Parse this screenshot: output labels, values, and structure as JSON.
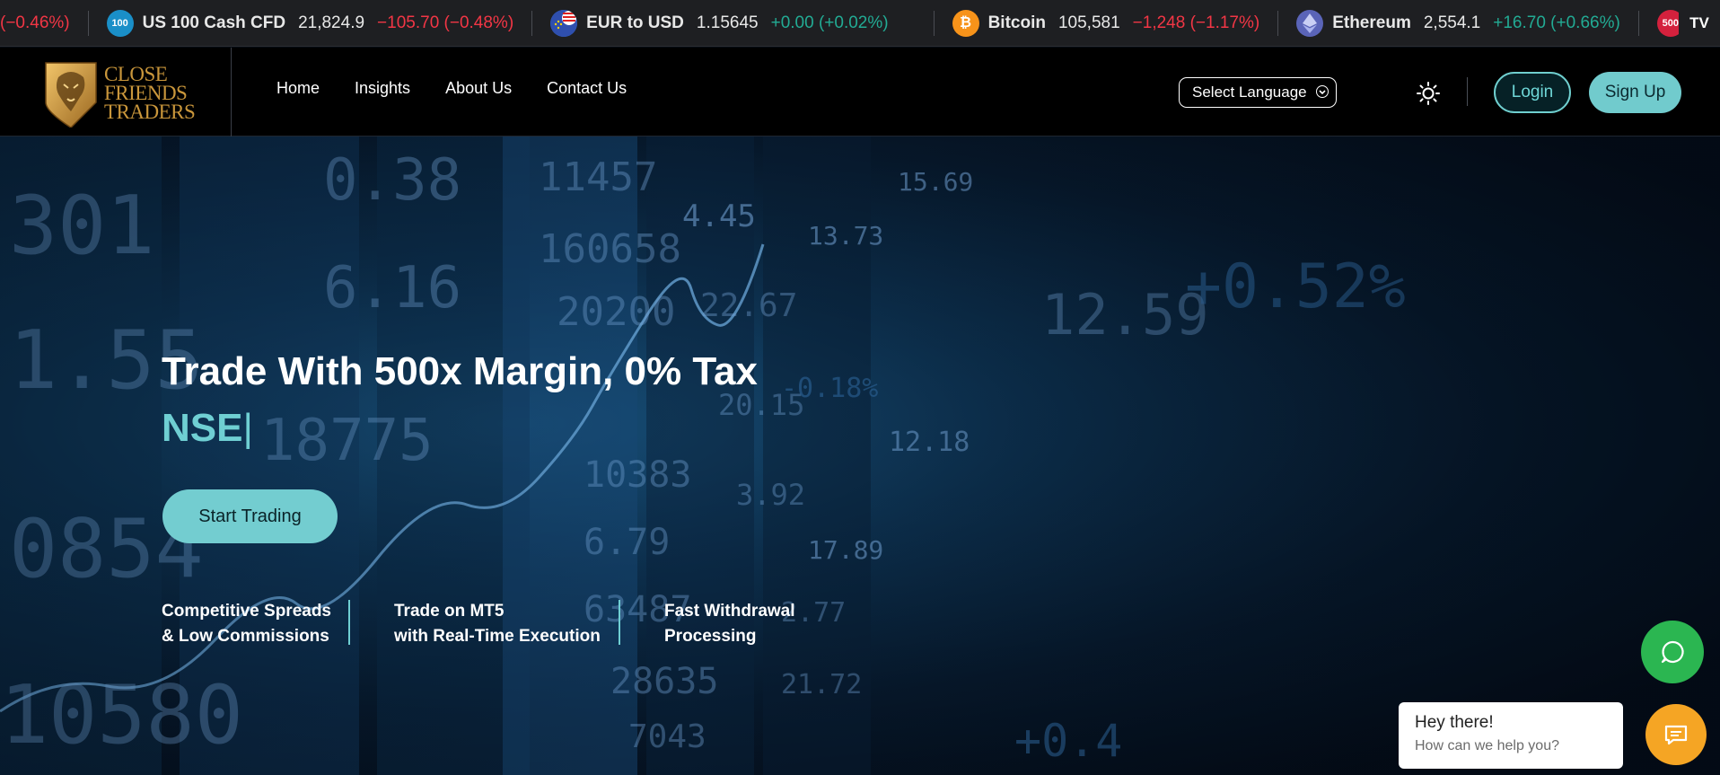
{
  "ticker": [
    {
      "name": "",
      "price": "",
      "change": "(−0.46%)",
      "direction": "neg",
      "badge": "",
      "badge_color": ""
    },
    {
      "name": "US 100 Cash CFD",
      "price": "21,824.9",
      "change": "−105.70 (−0.48%)",
      "direction": "neg",
      "badge": "100",
      "badge_color": "#1a8fc8"
    },
    {
      "name": "EUR to USD",
      "price": "1.15645",
      "change": "+0.00 (+0.02%)",
      "direction": "pos",
      "badge": "",
      "badge_color": "#2f6fd1",
      "price_dir": "neg"
    },
    {
      "name": "Bitcoin",
      "price": "105,581",
      "change": "−1,248 (−1.17%)",
      "direction": "neg",
      "badge": "₿",
      "badge_color": "#f7931a"
    },
    {
      "name": "Ethereum",
      "price": "2,554.1",
      "change": "+16.70 (+0.66%)",
      "direction": "pos",
      "badge": "",
      "badge_color": "#5a64b8"
    },
    {
      "name": "",
      "price": "",
      "change": "",
      "direction": "neg",
      "badge": "500",
      "badge_color": "#d4213d"
    }
  ],
  "tv_logo": "TV",
  "logo": {
    "line1": "CLOSE",
    "line2": "FRIENDS",
    "line3": "TRADERS",
    "color": "#c9963b"
  },
  "nav": [
    "Home",
    "Insights",
    "About Us",
    "Contact Us"
  ],
  "language_select": "Select Language",
  "login_label": "Login",
  "signup_label": "Sign Up",
  "hero": {
    "headline": "Trade With 500x Margin, 0% Tax",
    "typed_text": "NSE",
    "cursor": "|",
    "cta": "Start Trading",
    "features": [
      {
        "line1": "Competitive Spreads",
        "line2": "& Low Commissions"
      },
      {
        "line1": "Trade on MT5",
        "line2": "with Real-Time Execution"
      },
      {
        "line1": "Fast Withdrawal",
        "line2": "Processing"
      }
    ],
    "bg_numbers": [
      "0.38",
      "301",
      "6.16",
      "11457",
      "160658",
      "20200",
      "1.55",
      "18775",
      "10383",
      "6.79",
      "0854",
      "63487",
      "28635",
      "10580",
      "7043",
      "22.67",
      "20.15",
      "3.92",
      "2.77",
      "21.72",
      "12.59",
      "+0.52%",
      "+0.4",
      "-0.18%",
      "4.45",
      "13.73",
      "12.18",
      "17.89",
      "15.69"
    ]
  },
  "chat": {
    "greeting": "Hey there!",
    "prompt": "How can we help you?"
  },
  "colors": {
    "accent": "#71cbcd",
    "negative": "#f23645",
    "positive": "#22ab94",
    "whatsapp": "#2bb651",
    "chat": "#f5a524"
  }
}
